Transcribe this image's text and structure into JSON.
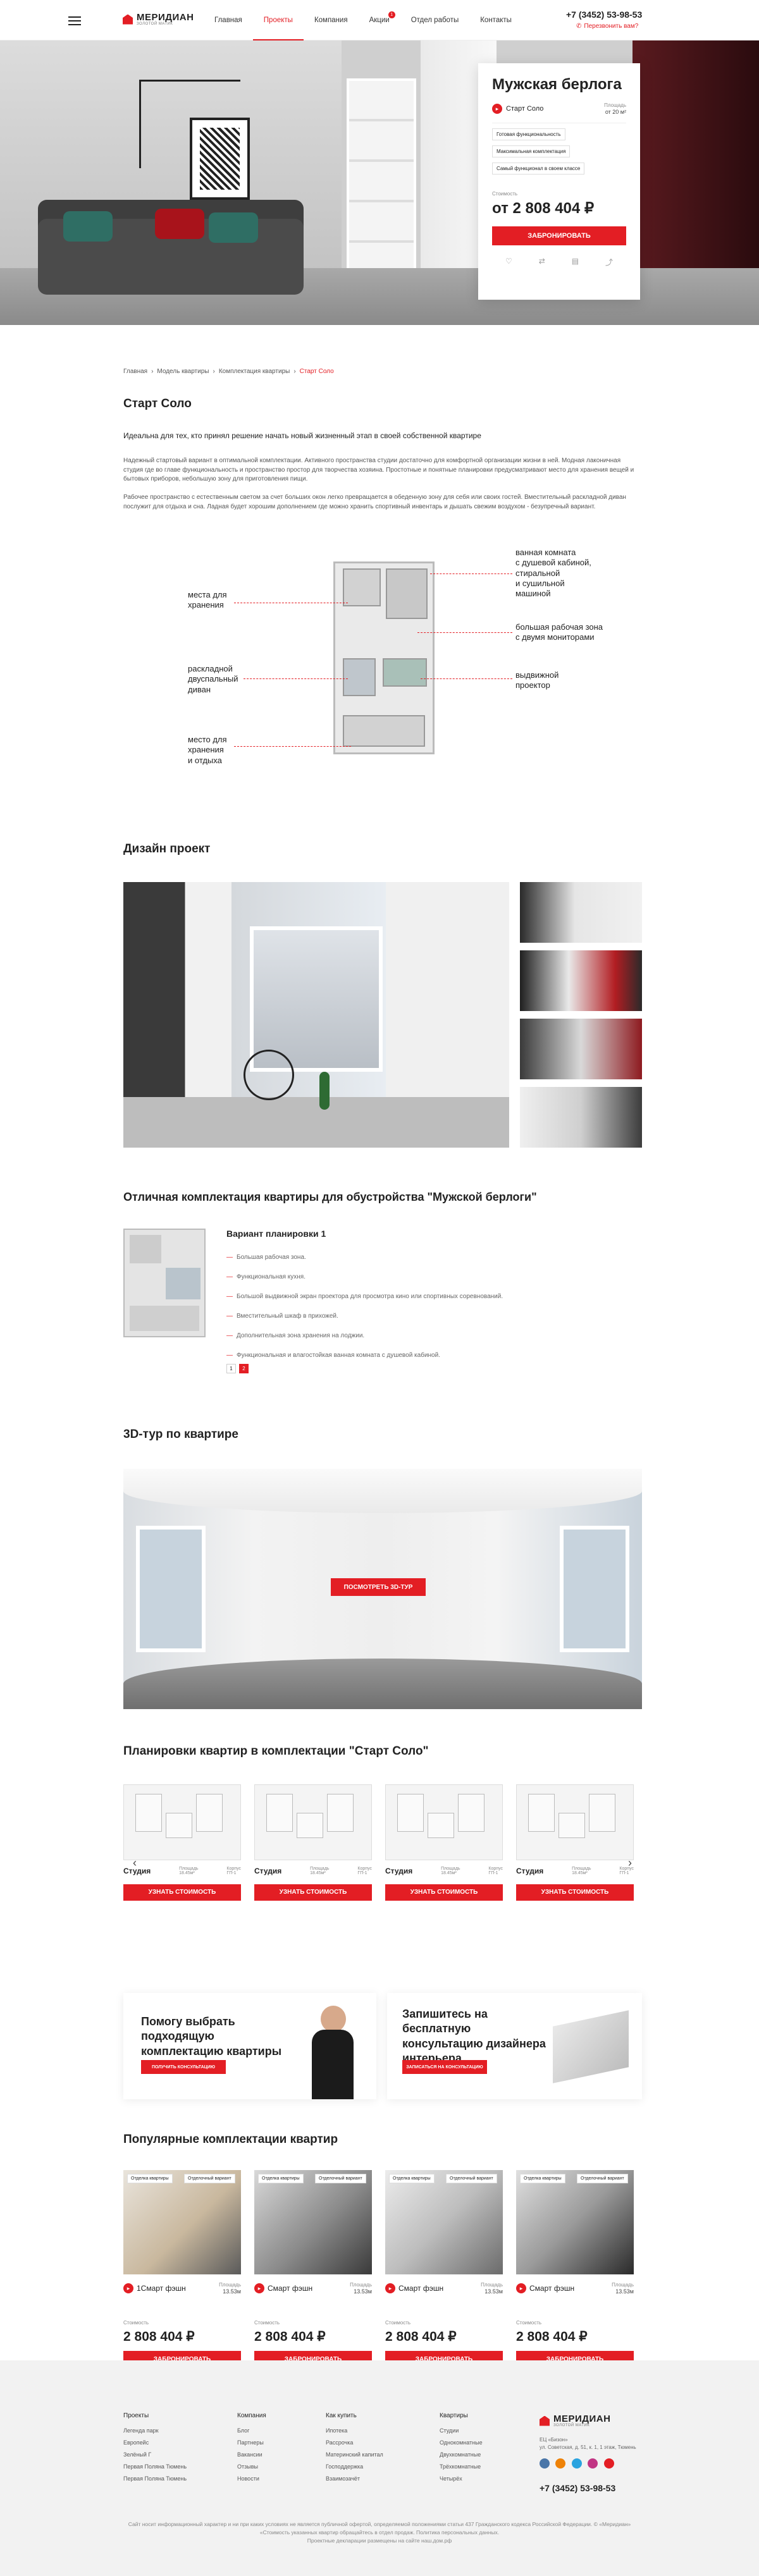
{
  "header": {
    "nav": [
      "Главная",
      "Проекты",
      "Компания",
      "Акции",
      "Отдел работы",
      "Контакты"
    ],
    "promo_badge": "1",
    "phone": "+7 (3452) 53-98-53",
    "callback": "Перезвонить вам?"
  },
  "logo": {
    "name": "МЕРИДИАН",
    "sub": "ЗОЛОТОЙ МАТИК"
  },
  "hero_card": {
    "title": "Мужская берлога",
    "pack": "Старт Соло",
    "area_label": "Площадь",
    "area": "от 20 м²",
    "tags": [
      "Готовая функциональность",
      "Максимальная комплектация",
      "Самый функционал в своем классе"
    ],
    "price_label": "Стоимость",
    "price": "от 2 808 404 ₽",
    "button": "ЗАБРОНИРОВАТЬ"
  },
  "breadcrumbs": [
    "Главная",
    "Модель квартиры",
    "Комплектация квартиры",
    "Старт Соло"
  ],
  "intro": {
    "title": "Старт Соло",
    "lead": "Идеальна для тех, кто принял решение начать новый жизненный этап в своей собственной квартире",
    "p1": "Надежный стартовый вариант в оптимальной комплектации. Активного пространства студии достаточно для комфортной организации жизни в ней. Модная лаконичная студия где во главе функциональность и пространство простор для творчества хозяина. Простотные и понятные планировки предусматривают место для хранения вещей и бытовых приборов, небольшую зону для приготовления пищи.",
    "p2": "Рабочее пространство с естественным светом за счет больших окон легко превращается в обеденную зону для себя или своих гостей. Вместительный раскладной диван послужит для отдыха и сна. Ладная будет хорошим дополнением где можно хранить спортивный инвентарь и дышать свежим воздухом - безупречный вариант."
  },
  "scheme": {
    "left": [
      "места для\nхранения",
      "раскладной\nдвуспальный\nдиван",
      "место для\nхранения\nи отдыха"
    ],
    "right": [
      "ванная комната\nс душевой кабиной,\nстиральной\nи сушильной\nмашиной",
      "большая рабочая зона\nс двумя мониторами",
      "выдвижной\nпроектор"
    ]
  },
  "design": {
    "title": "Дизайн проект"
  },
  "variant": {
    "title": "Отличная комплектация квартиры для обустройства \"Мужской берлоги\"",
    "name": "Вариант планировки 1",
    "items": [
      "Большая рабочая зона.",
      "Функциональная кухня.",
      "Большой выдвижной экран проектора для просмотра кино или спортивных соревнований.",
      "Вместительный шкаф в прихожей.",
      "Дополнительная зона хранения на лоджии.",
      "Функциональная и влагостойкая ванная комната с душевой кабиной."
    ],
    "pages": [
      "1",
      "2"
    ]
  },
  "tour": {
    "title": "3D-тур по квартире",
    "button": "ПОСМОТРЕТЬ 3D-тур"
  },
  "plans": {
    "title": "Планировки квартир в комплектации \"Старт Соло\"",
    "cards": [
      {
        "type": "Студия",
        "area_l": "Площадь",
        "area": "18.45м²",
        "floor_l": "Корпус",
        "floor": "ГП-1",
        "button": "УЗНАТЬ СТОИМОСТЬ"
      },
      {
        "type": "Студия",
        "area_l": "Площадь",
        "area": "18.45м²",
        "floor_l": "Корпус",
        "floor": "ГП-1",
        "button": "УЗНАТЬ СТОИМОСТЬ"
      },
      {
        "type": "Студия",
        "area_l": "Площадь",
        "area": "18.45м²",
        "floor_l": "Корпус",
        "floor": "ГП-1",
        "button": "УЗНАТЬ СТОИМОСТЬ"
      },
      {
        "type": "Студия",
        "area_l": "Площадь",
        "area": "18.45м²",
        "floor_l": "Корпус",
        "floor": "ГП-1",
        "button": "УЗНАТЬ СТОИМОСТЬ"
      }
    ]
  },
  "promo": {
    "left_title": "Помогу выбрать подходящую комплектацию квартиры",
    "left_btn": "ПОЛУЧИТЬ КОНСУЛЬТАЦИЮ",
    "right_title": "Запишитесь на бесплатную консультацию дизайнера интерьера",
    "right_btn": "ЗАПИСАТЬСЯ НА КОНСУЛЬТАЦИЮ"
  },
  "popular": {
    "title": "Популярные комплектации квартир",
    "cards": [
      {
        "name": "1Смарт фэшн",
        "tag1": "Отделка квартиры",
        "tag2": "Отделочный вариант",
        "area_l": "Площадь",
        "area": "13.53м",
        "price_l": "Стоимость",
        "price": "2 808 404 ₽",
        "button": "ЗАБРОНИРОВАТЬ"
      },
      {
        "name": "Смарт фэшн",
        "tag1": "Отделка квартиры",
        "tag2": "Отделочный вариант",
        "area_l": "Площадь",
        "area": "13.53м",
        "price_l": "Стоимость",
        "price": "2 808 404 ₽",
        "button": "ЗАБРОНИРОВАТЬ"
      },
      {
        "name": "Смарт фэшн",
        "tag1": "Отделка квартиры",
        "tag2": "Отделочный вариант",
        "area_l": "Площадь",
        "area": "13.53м",
        "price_l": "Стоимость",
        "price": "2 808 404 ₽",
        "button": "ЗАБРОНИРОВАТЬ"
      },
      {
        "name": "Смарт фэшн",
        "tag1": "Отделка квартиры",
        "tag2": "Отделочный вариант",
        "area_l": "Площадь",
        "area": "13.53м",
        "price_l": "Стоимость",
        "price": "2 808 404 ₽",
        "button": "ЗАБРОНИРОВАТЬ"
      }
    ]
  },
  "footer": {
    "cols": [
      {
        "title": "Проекты",
        "items": [
          "Легенда парк",
          "Европейс",
          "Зелёный Г",
          "Первая Поляна Тюмень",
          "Первая Поляна Тюмень"
        ]
      },
      {
        "title": "Компания",
        "items": [
          "Блог",
          "Партнеры",
          "Вакансии",
          "Отзывы",
          "Новости"
        ]
      },
      {
        "title": "Как купить",
        "items": [
          "Ипотека",
          "Рассрочка",
          "Материнский капитал",
          "Господдержка",
          "Взаимозачёт"
        ]
      },
      {
        "title": "Квартиры",
        "items": [
          "Студии",
          "Однокомнатные",
          "Двухкомнатные",
          "Трёхкомнатные",
          "Четырёх"
        ]
      }
    ],
    "brand": "МЕРИДИАН",
    "brand_sub": "ЗОЛОТОЙ МАТИК",
    "address": "ЕЦ «Бизон»\nул. Советская, д. 51, к. 1, 1 этаж, Тюмень",
    "phone": "+7 (3452) 53-98-53",
    "note": "Сайт носит информационный характер и ни при каких условиях не является публичной офертой, определяемой положениями статьи 437 Гражданского кодекса Российской Федерации. © «Меридиан»\n«Стоимость указанных квартир обращайтесь в отдел продаж. Политика персональных данных.\nПроектные декларации размещены на сайте наш.дом.рф"
  },
  "colors": {
    "accent": "#e31e24"
  }
}
